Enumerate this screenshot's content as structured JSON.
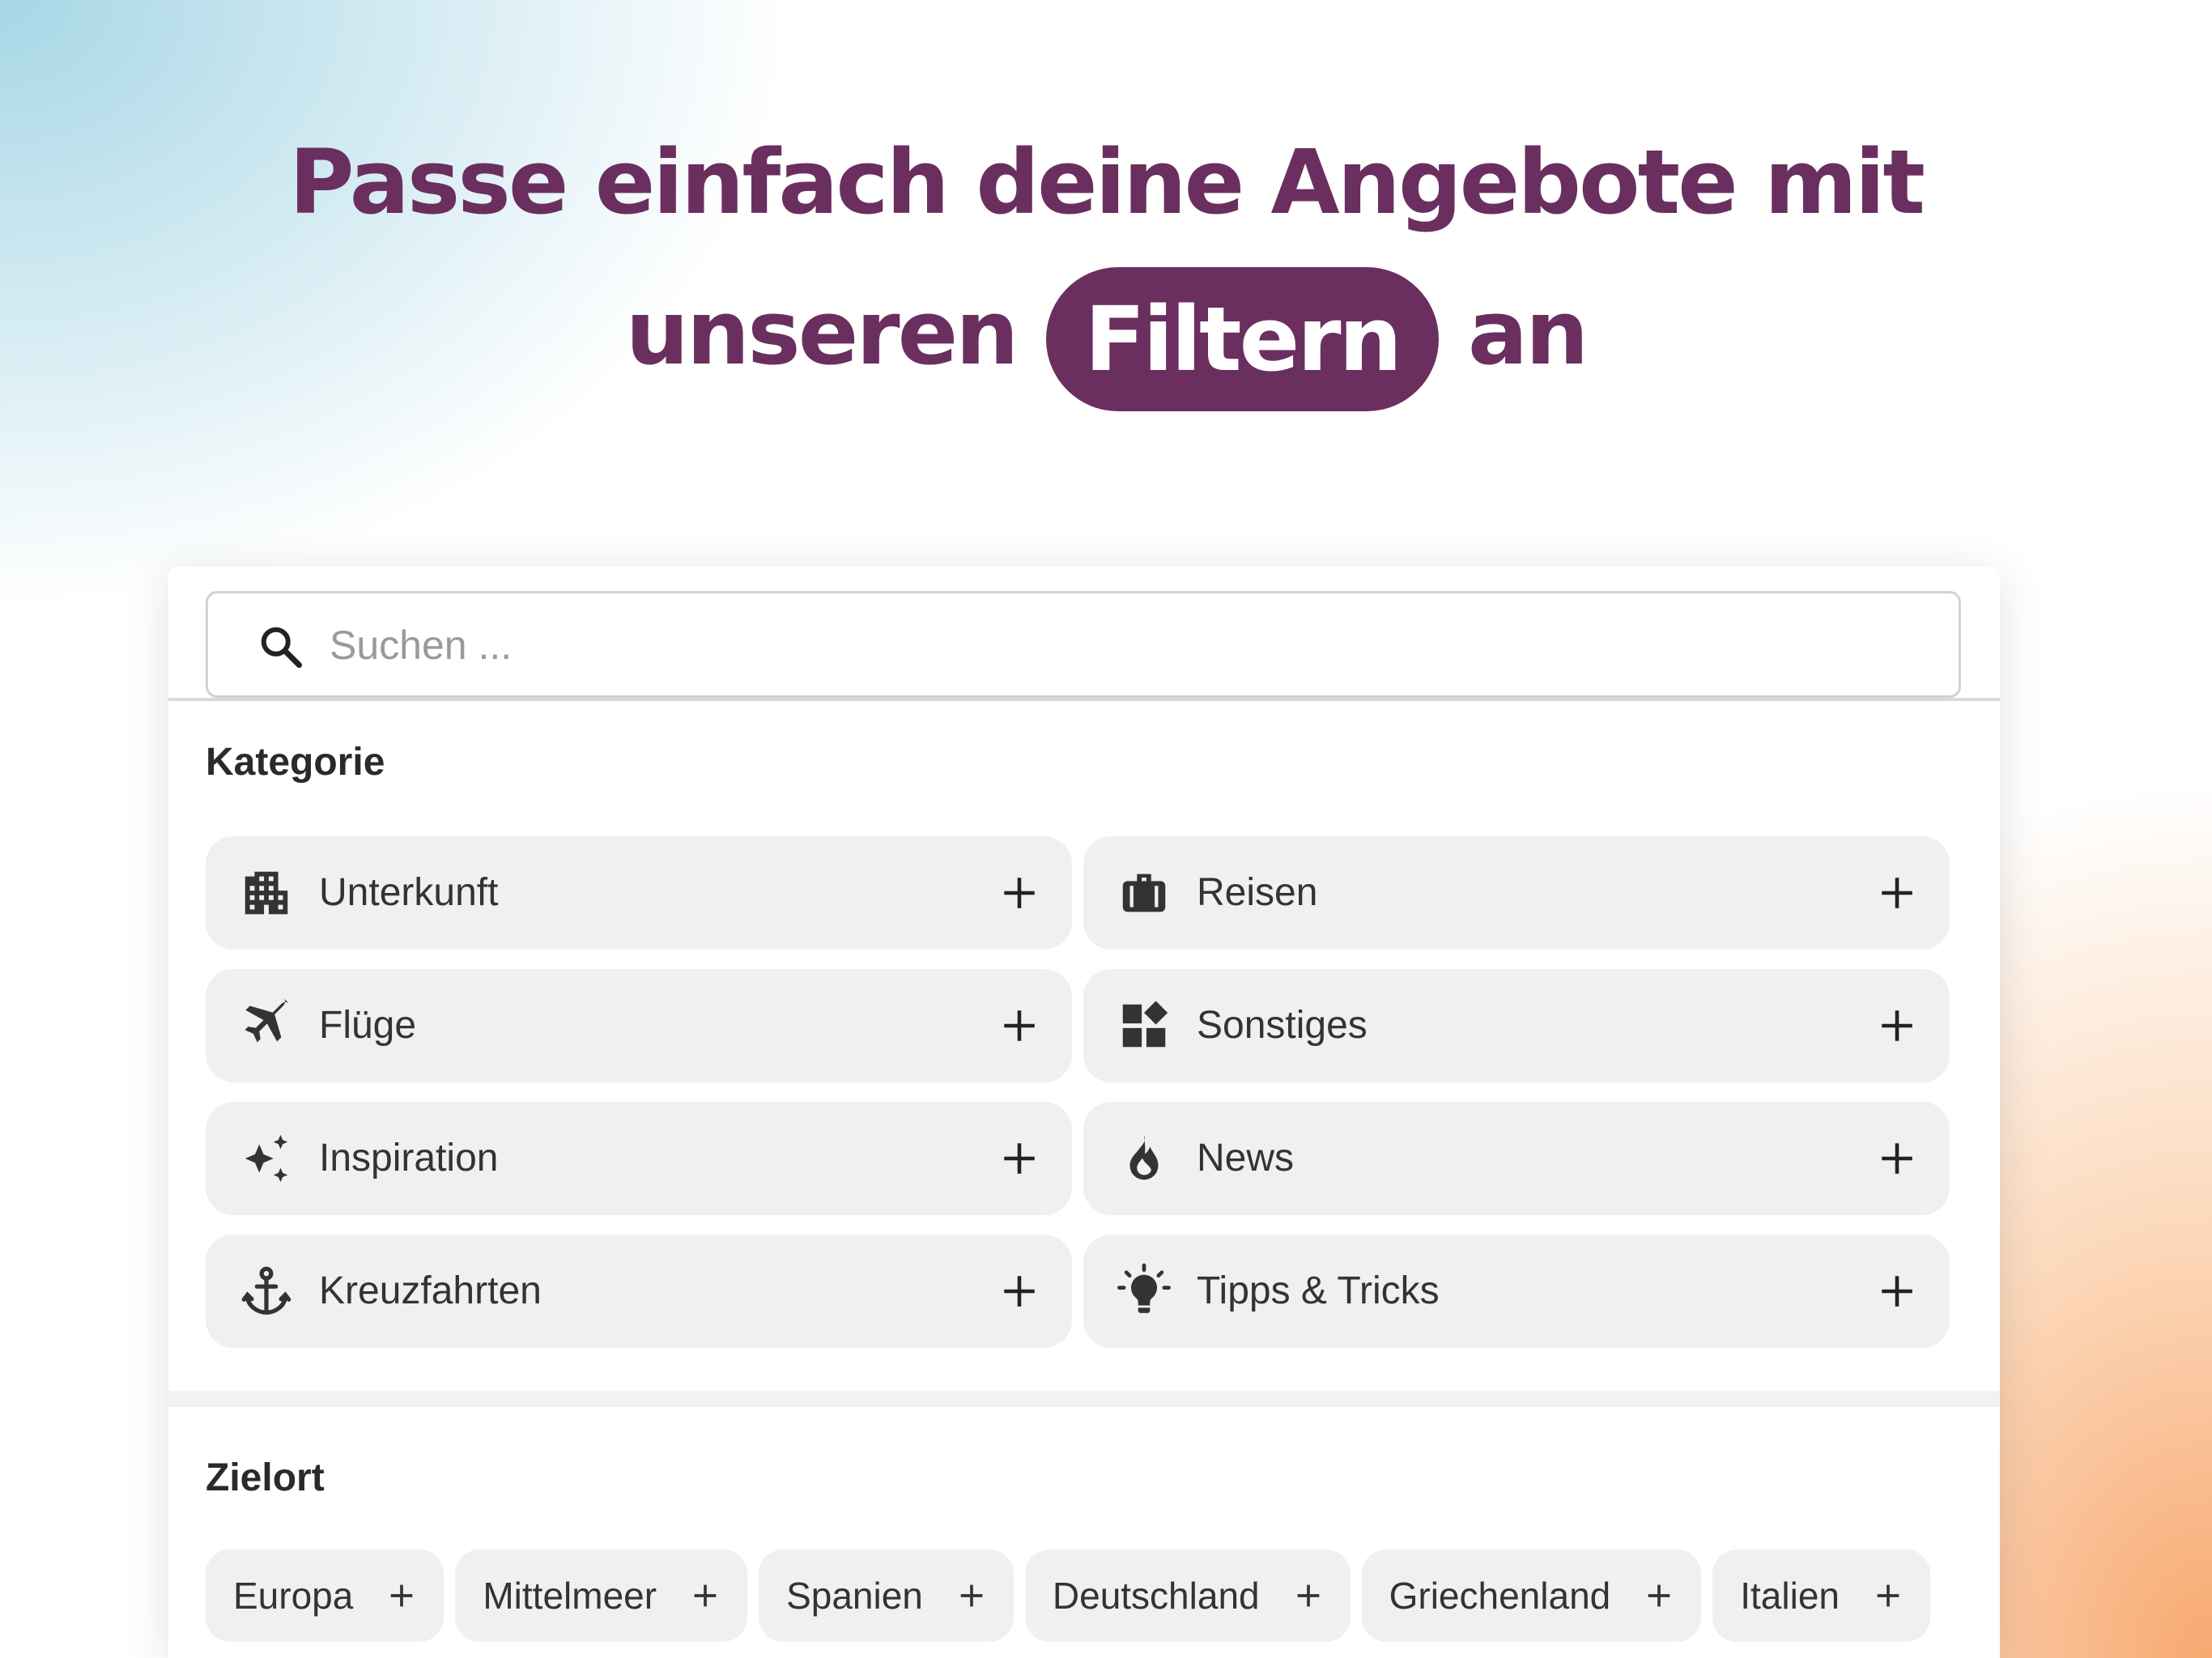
{
  "headline": {
    "line1": "Passe einfach deine Angebote mit",
    "line2_before": "unseren",
    "highlight": "Filtern",
    "line2_after": "an"
  },
  "search": {
    "placeholder": "Suchen ...",
    "icon": "search-icon"
  },
  "kategorie": {
    "title": "Kategorie",
    "items": [
      {
        "label": "Unterkunft",
        "icon": "building-icon"
      },
      {
        "label": "Reisen",
        "icon": "luggage-icon"
      },
      {
        "label": "Flüge",
        "icon": "airplane-icon"
      },
      {
        "label": "Sonstiges",
        "icon": "widgets-icon"
      },
      {
        "label": "Inspiration",
        "icon": "sparkle-icon"
      },
      {
        "label": "News",
        "icon": "flame-icon"
      },
      {
        "label": "Kreuzfahrten",
        "icon": "anchor-icon"
      },
      {
        "label": "Tipps & Tricks",
        "icon": "lightbulb-icon"
      }
    ]
  },
  "zielort": {
    "title": "Zielort",
    "chips": [
      "Europa",
      "Mittelmeer",
      "Spanien",
      "Deutschland",
      "Griechenland",
      "Italien"
    ]
  },
  "colors": {
    "brand": "#6a2f5f",
    "chip_bg": "#f0f0f0",
    "text": "#333333"
  }
}
